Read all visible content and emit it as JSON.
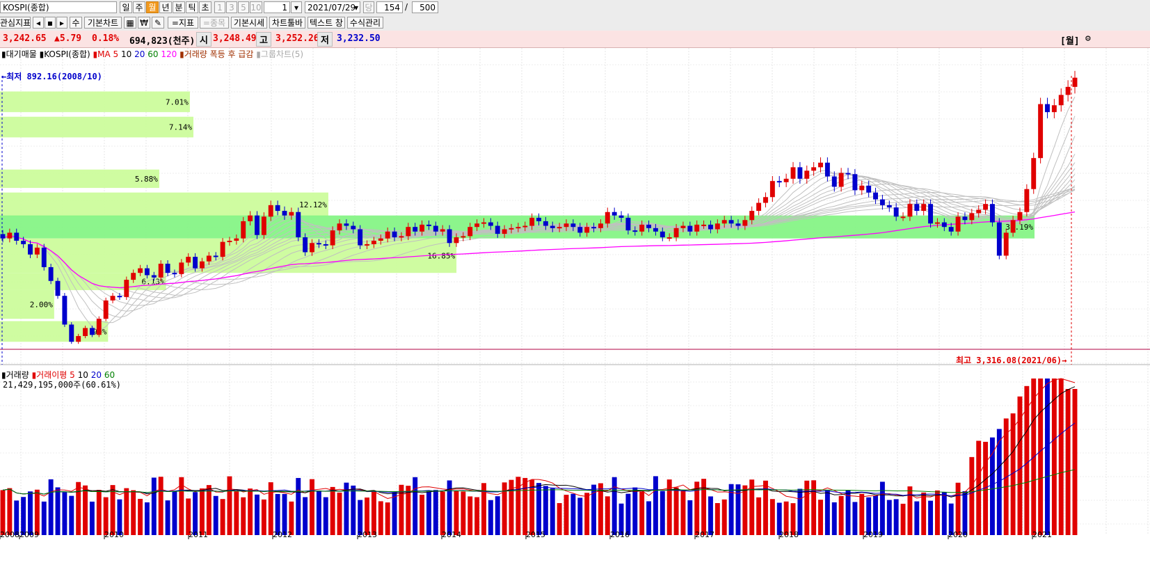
{
  "toolbar": {
    "symbol": "KOSPI(종합)",
    "periods": [
      "일",
      "주",
      "월",
      "년",
      "분",
      "틱",
      "초"
    ],
    "selected_period": "월",
    "intervals": [
      "1",
      "3",
      "5",
      "10"
    ],
    "interval_value": "1",
    "date": "2021/07/29",
    "dang": "당",
    "count": "154",
    "slash": "/",
    "total": "500",
    "watch_indicator": "관심지표",
    "su": "수",
    "basic_chart": "기본차트",
    "indicator_btn": "=지표",
    "item_btn": "=종목",
    "basic_quote": "기본시세",
    "chart_toolbar": "차트툴바",
    "text_toggle": "텍스트 창",
    "formula_mgmt": "수식관리",
    "icon_arrows": "◀ ■ ▶"
  },
  "price": {
    "current": "3,242.65",
    "change": "▲5.79",
    "change_pct": "0.18%",
    "volume": "694,823(천주)",
    "open_label": "시",
    "open": "3,248.49",
    "high_label": "고",
    "high": "3,252.26",
    "low_label": "저",
    "low": "3,232.50",
    "period_tag": "[월]",
    "colors": {
      "up": "#e00000",
      "down": "#0000cc"
    }
  },
  "legend": {
    "items": [
      "대기매물",
      "KOSPI(종합)",
      "MA",
      "5",
      "10",
      "20",
      "60",
      "120",
      "거래량 폭등 후 급감",
      "그룹차트(5)"
    ],
    "colors": [
      "#000",
      "#000",
      "#e00000",
      "#e00000",
      "#000",
      "#0000cc",
      "#008000",
      "#ff00ff",
      "#a03000",
      "#aaaaaa"
    ]
  },
  "annotations": {
    "low": "←최저 892.16(2008/10)",
    "high": "최고 3,316.08(2021/06)→"
  },
  "volume_panel": {
    "legend": [
      "거래량",
      "거래이평",
      "5",
      "10",
      "20",
      "60"
    ],
    "value": "21,429,195,000주(60.61%)"
  },
  "chart_data": {
    "type": "candlestick",
    "price_axis": {
      "min": 892.16,
      "max": 3316.08
    },
    "volume_profile": [
      {
        "pct": "7.01%",
        "low": 3000,
        "high": 3180
      },
      {
        "pct": "7.14%",
        "low": 2780,
        "high": 2960
      },
      {
        "pct": "5.88%",
        "low": 2340,
        "high": 2500
      },
      {
        "pct": "12.12%",
        "low": 2090,
        "high": 2300
      },
      {
        "pct": "38.19%",
        "low": 1900,
        "high": 2100
      },
      {
        "pct": "16.85%",
        "low": 1600,
        "high": 1900
      },
      {
        "pct": "6.13%",
        "low": 1450,
        "high": 1600
      },
      {
        "pct": "2.00%",
        "low": 1200,
        "high": 1450
      },
      {
        "pct": "3.99%",
        "low": 1000,
        "high": 1180
      }
    ],
    "x_labels": [
      "2008",
      "2009",
      "2010",
      "2011",
      "2012",
      "2013",
      "2014",
      "2015",
      "2016",
      "2017",
      "2018",
      "2019",
      "2020",
      "2021"
    ],
    "monthly_closes": [
      1900,
      1950,
      1880,
      1850,
      1760,
      1820,
      1650,
      1530,
      1400,
      1150,
      1000,
      1050,
      1120,
      1060,
      1200,
      1360,
      1400,
      1390,
      1540,
      1600,
      1640,
      1580,
      1560,
      1680,
      1600,
      1590,
      1690,
      1740,
      1640,
      1700,
      1750,
      1740,
      1870,
      1880,
      1900,
      2050,
      2100,
      1930,
      2090,
      2190,
      2140,
      2100,
      2130,
      1910,
      1780,
      1860,
      1850,
      1840,
      1970,
      2030,
      2010,
      1980,
      1840,
      1850,
      1880,
      1900,
      1960,
      1910,
      1920,
      2000,
      1960,
      2020,
      2010,
      1960,
      1980,
      1860,
      1910,
      1920,
      2000,
      2030,
      2040,
      2010,
      1940,
      1980,
      1990,
      2000,
      2010,
      2080,
      2050,
      2010,
      1990,
      2000,
      2030,
      2000,
      1950,
      2000,
      1990,
      2030,
      2130,
      2100,
      2080,
      1970,
      1960,
      2020,
      1990,
      1960,
      1910,
      1910,
      1990,
      2010,
      1960,
      2020,
      2020,
      1980,
      2030,
      2060,
      2030,
      2010,
      2060,
      2140,
      2210,
      2260,
      2400,
      2390,
      2420,
      2520,
      2420,
      2490,
      2520,
      2560,
      2440,
      2350,
      2470,
      2460,
      2320,
      2360,
      2300,
      2240,
      2190,
      2170,
      2090,
      2090,
      2200,
      2140,
      2200,
      2030,
      2040,
      2000,
      1960,
      2090,
      2060,
      2120,
      2150,
      2200,
      2040,
      1750,
      1950,
      2060,
      2130,
      2330,
      2600,
      3070,
      3000,
      3060,
      3150,
      3220,
      3300
    ]
  }
}
